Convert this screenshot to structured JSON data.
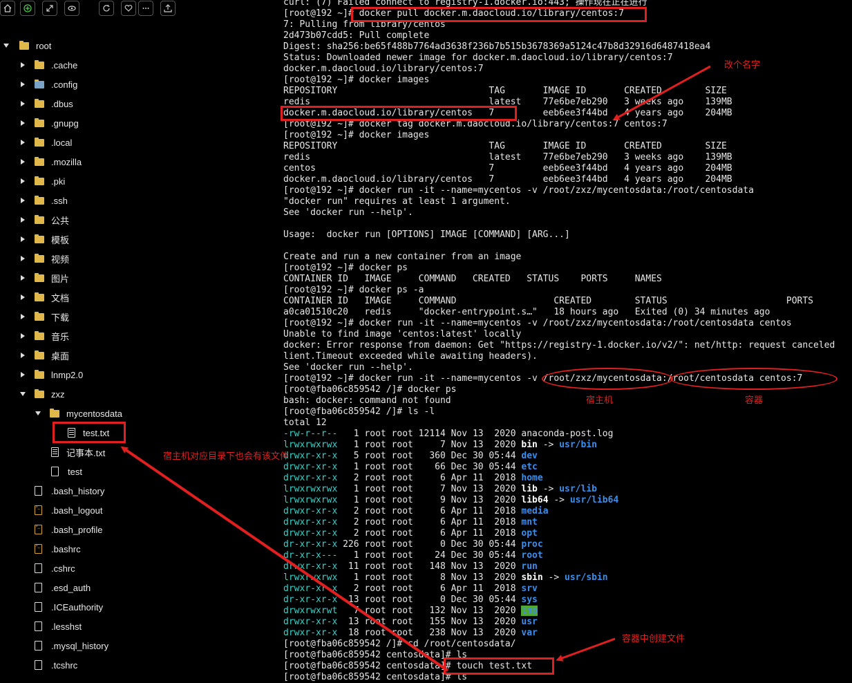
{
  "toolbar": {
    "buttons": [
      "home-icon",
      "add-circle-icon",
      "expand-icon",
      "eye-icon",
      "refresh-icon",
      "heart-icon",
      "more-icon",
      "upload-icon"
    ]
  },
  "tree": {
    "root": "root",
    "items": [
      {
        "label": ".cache",
        "icon": "folder-icon"
      },
      {
        "label": ".config",
        "icon": "folder-gear-icon"
      },
      {
        "label": ".dbus",
        "icon": "folder-icon"
      },
      {
        "label": ".gnupg",
        "icon": "folder-icon"
      },
      {
        "label": ".local",
        "icon": "folder-icon"
      },
      {
        "label": ".mozilla",
        "icon": "folder-icon"
      },
      {
        "label": ".pki",
        "icon": "folder-icon"
      },
      {
        "label": ".ssh",
        "icon": "folder-icon"
      },
      {
        "label": "公共",
        "icon": "folder-icon"
      },
      {
        "label": "模板",
        "icon": "folder-icon"
      },
      {
        "label": "视频",
        "icon": "folder-icon"
      },
      {
        "label": "图片",
        "icon": "folder-icon"
      },
      {
        "label": "文档",
        "icon": "folder-icon"
      },
      {
        "label": "下载",
        "icon": "folder-icon"
      },
      {
        "label": "音乐",
        "icon": "folder-icon"
      },
      {
        "label": "桌面",
        "icon": "folder-icon"
      },
      {
        "label": "lnmp2.0",
        "icon": "folder-icon"
      },
      {
        "label": "zxz",
        "icon": "folder-icon"
      }
    ],
    "mycentosdata": "mycentosdata",
    "testtxt": "test.txt",
    "notebook": "记事本.txt",
    "test": "test",
    "files": [
      ".bash_history",
      ".bash_logout",
      ".bash_profile",
      ".bashrc",
      ".cshrc",
      ".esd_auth",
      ".ICEauthority",
      ".lesshst",
      ".mysql_history",
      ".tcshrc"
    ]
  },
  "annotations": {
    "rename": "改个名字",
    "host": "宿主机",
    "container": "容器",
    "host_file_note": "宿主机对应目录下也会有该文件",
    "container_create": "容器中创建文件"
  },
  "terminal": {
    "lines": [
      "curl: (7) Failed connect to registry-1.docker.io:443; 操作现在正在进行",
      "[root@192 ~]# docker pull docker.m.daocloud.io/library/centos:7",
      "7: Pulling from library/centos",
      "2d473b07cdd5: Pull complete",
      "Digest: sha256:be65f488b7764ad3638f236b7b515b3678369a5124c47b8d32916d6487418ea4",
      "Status: Downloaded newer image for docker.m.daocloud.io/library/centos:7",
      "docker.m.daocloud.io/library/centos:7",
      "[root@192 ~]# docker images",
      "REPOSITORY                            TAG       IMAGE ID       CREATED        SIZE",
      "redis                                 latest    77e6be7eb290   3 weeks ago    139MB",
      "docker.m.daocloud.io/library/centos   7         eeb6ee3f44bd   4 years ago    204MB",
      "[root@192 ~]# docker tag docker.m.daocloud.io/library/centos:7 centos:7",
      "[root@192 ~]# docker images",
      "REPOSITORY                            TAG       IMAGE ID       CREATED        SIZE",
      "redis                                 latest    77e6be7eb290   3 weeks ago    139MB",
      "centos                                7         eeb6ee3f44bd   4 years ago    204MB",
      "docker.m.daocloud.io/library/centos   7         eeb6ee3f44bd   4 years ago    204MB",
      "[root@192 ~]# docker run -it --name=mycentos -v /root/zxz/mycentosdata:/root/centosdata",
      "\"docker run\" requires at least 1 argument.",
      "See 'docker run --help'.",
      "",
      "Usage:  docker run [OPTIONS] IMAGE [COMMAND] [ARG...]",
      "",
      "Create and run a new container from an image",
      "[root@192 ~]# docker ps",
      "CONTAINER ID   IMAGE     COMMAND   CREATED   STATUS    PORTS     NAMES",
      "[root@192 ~]# docker ps -a",
      "CONTAINER ID   IMAGE     COMMAND                  CREATED        STATUS                      PORTS",
      "a0ca01510c20   redis     \"docker-entrypoint.s…\"   18 hours ago   Exited (0) 34 minutes ago",
      "[root@192 ~]# docker run -it --name=mycentos -v /root/zxz/mycentosdata:/root/centosdata centos",
      "Unable to find image 'centos:latest' locally",
      "docker: Error response from daemon: Get \"https://registry-1.docker.io/v2/\": net/http: request canceled",
      "lient.Timeout exceeded while awaiting headers).",
      "See 'docker run --help'.",
      "[root@192 ~]# docker run -it --name=mycentos -v /root/zxz/mycentosdata:/root/centosdata centos:7",
      "[root@fba06c859542 /]# docker ps",
      "bash: docker: command not found",
      "[root@fba06c859542 /]# ls -l",
      "total 12",
      "-rw-r--r--   1 root root 12114 Nov 13  2020 anaconda-post.log",
      "lrwxrwxrwx   1 root root     7 Nov 13  2020 bin -> usr/bin",
      "drwxr-xr-x   5 root root   360 Dec 30 05:44 dev",
      "drwxr-xr-x   1 root root    66 Dec 30 05:44 etc",
      "drwxr-xr-x   2 root root     6 Apr 11  2018 home",
      "lrwxrwxrwx   1 root root     7 Nov 13  2020 lib -> usr/lib",
      "lrwxrwxrwx   1 root root     9 Nov 13  2020 lib64 -> usr/lib64",
      "drwxr-xr-x   2 root root     6 Apr 11  2018 media",
      "drwxr-xr-x   2 root root     6 Apr 11  2018 mnt",
      "drwxr-xr-x   2 root root     6 Apr 11  2018 opt",
      "dr-xr-xr-x 226 root root     0 Dec 30 05:44 proc",
      "dr-xr-x---   1 root root    24 Dec 30 05:44 root",
      "drwxr-xr-x  11 root root   148 Nov 13  2020 run",
      "lrwxrwxrwx   1 root root     8 Nov 13  2020 sbin -> usr/sbin",
      "drwxr-xr-x   2 root root     6 Apr 11  2018 srv",
      "dr-xr-xr-x  13 root root     0 Dec 30 05:44 sys",
      "drwxrwxrwt   7 root root   132 Nov 13  2020 tmp",
      "drwxr-xr-x  13 root root   155 Nov 13  2020 usr",
      "drwxr-xr-x  18 root root   238 Nov 13  2020 var",
      "[root@fba06c859542 /]# cd /root/centosdata/",
      "[root@fba06c859542 centosdata]# ls",
      "[root@fba06c859542 centosdata]# touch test.txt",
      "[root@fba06c859542 centosdata]# ls"
    ]
  }
}
